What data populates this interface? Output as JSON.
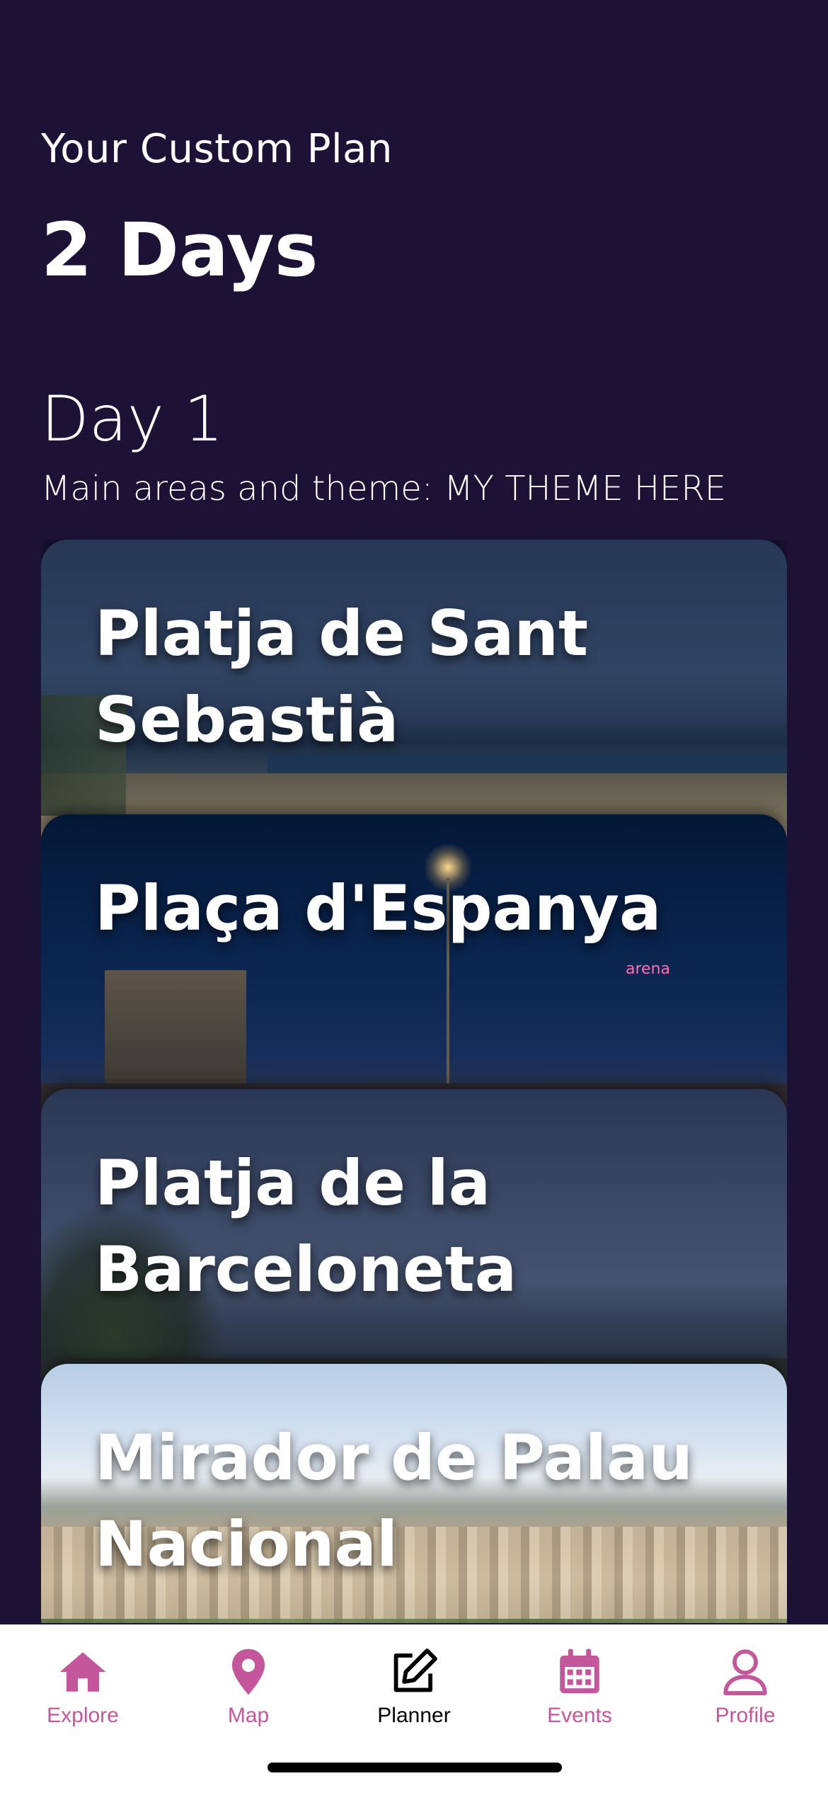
{
  "header": {
    "subtitle": "Your Custom Plan",
    "title": "2 Days"
  },
  "day": {
    "title": "Day 1",
    "theme": "Main areas and theme: MY THEME HERE"
  },
  "places": [
    {
      "name": "Platja de Sant Sebastià"
    },
    {
      "name": "Plaça d'Espanya"
    },
    {
      "name": "Platja de la Barceloneta"
    },
    {
      "name": "Mirador de Palau Nacional"
    }
  ],
  "card_photo_text": {
    "arena": "arena"
  },
  "tabbar": {
    "tabs": [
      {
        "label": "Explore",
        "icon": "home-icon",
        "active": false
      },
      {
        "label": "Map",
        "icon": "map-pin-icon",
        "active": false
      },
      {
        "label": "Planner",
        "icon": "edit-icon",
        "active": true
      },
      {
        "label": "Events",
        "icon": "calendar-icon",
        "active": false
      },
      {
        "label": "Profile",
        "icon": "user-icon",
        "active": false
      }
    ]
  },
  "colors": {
    "background": "#1b1236",
    "accent": "#c4579c",
    "active_tab": "#000000",
    "tabbar_bg": "#ffffff"
  }
}
